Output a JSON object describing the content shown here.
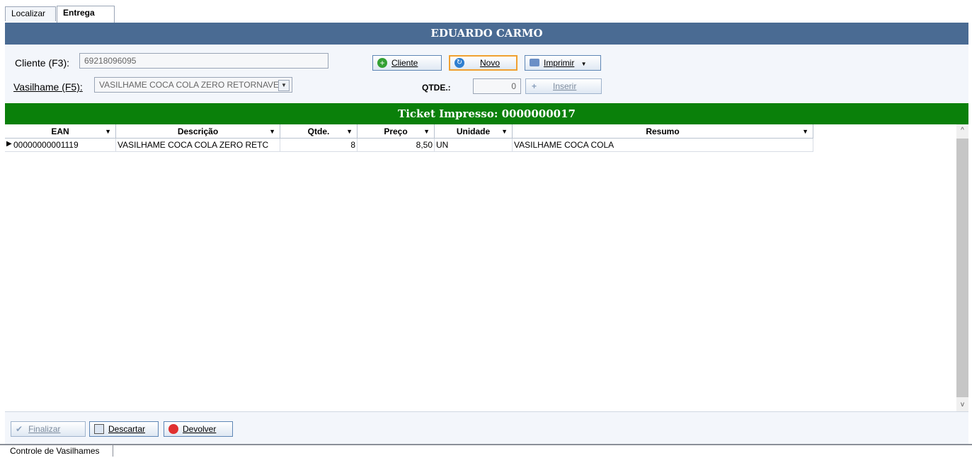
{
  "tabs": [
    "Localizar",
    "Entrega"
  ],
  "header": {
    "title": "EDUARDO CARMO"
  },
  "form": {
    "cliente_label": "Cliente (F3):",
    "cliente_value": "69218096095",
    "vasilhame_label": "Vasilhame (F5):",
    "vasilhame_value": "VASILHAME COCA COLA ZERO RETORNAVEL",
    "qtde_label": "QTDE.:",
    "qtde_value": "0"
  },
  "buttons": {
    "cliente": "Cliente",
    "novo": "Novo",
    "imprimir": "Imprimir",
    "inserir": "Inserir",
    "finalizar": "Finalizar",
    "descartar": "Descartar",
    "devolver": "Devolver"
  },
  "ticket": {
    "label": "Ticket Impresso: 0000000017"
  },
  "grid": {
    "columns": [
      "EAN",
      "Descrição",
      "Qtde.",
      "Preço",
      "Unidade",
      "Resumo"
    ],
    "rows": [
      [
        "00000000001119",
        "VASILHAME COCA COLA ZERO RETC",
        "8",
        "8,50",
        "UN",
        "VASILHAME COCA COLA"
      ]
    ]
  },
  "status": {
    "text": "Controle de Vasilhames"
  },
  "colors": {
    "header": "#4a6b93",
    "ticket": "#0a800a",
    "accent": "#f0a030"
  },
  "icons": [
    "plus-circle-icon",
    "refresh-icon",
    "printer-icon",
    "dropdown-arrow-icon",
    "checkmark-icon",
    "discard-icon",
    "stop-icon"
  ]
}
